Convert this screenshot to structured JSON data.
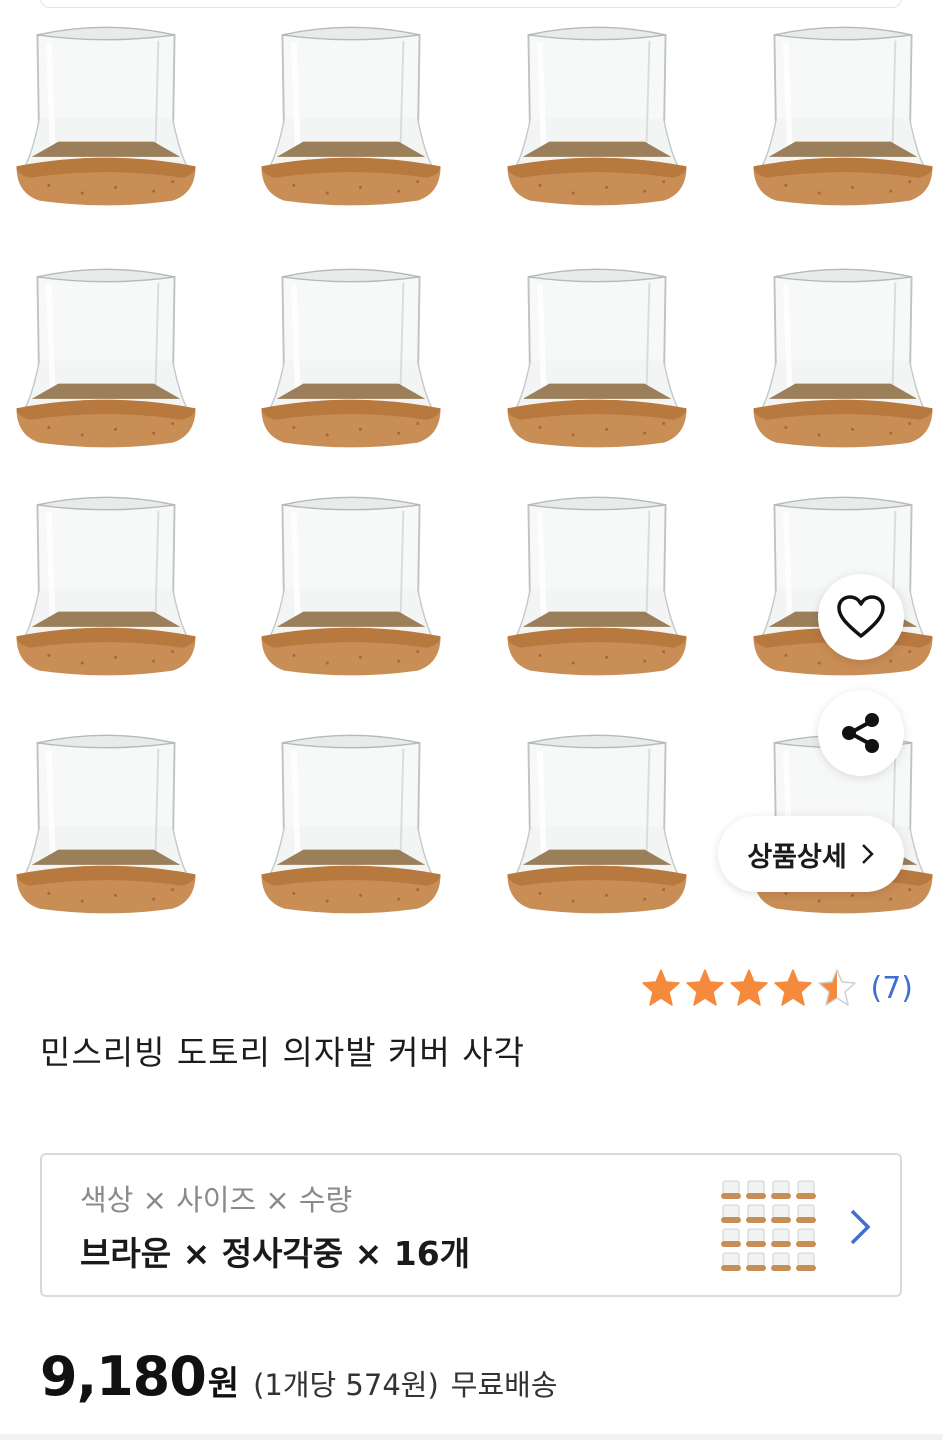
{
  "product": {
    "title": "민스리빙 도토리 의자발 커버 사각",
    "image_alt": "product-photo",
    "grid": {
      "rows": 4,
      "cols": 4
    }
  },
  "actions": {
    "wishlist_icon": "heart-outline-icon",
    "share_icon": "share-icon",
    "detail_label": "상품상세",
    "detail_icon": "chevron-right-icon"
  },
  "rating": {
    "stars": 4.5,
    "max": 5,
    "count_text": "(7)",
    "star_color": "#f58a3c"
  },
  "option": {
    "label": "색상 × 사이즈 × 수량",
    "value": "브라운 × 정사각중 × 16개",
    "chevron_icon": "chevron-right-icon",
    "chevron_color": "#3d6fcf"
  },
  "price": {
    "amount": "9,180",
    "currency": "원",
    "unit_price": "(1개당 574원)",
    "shipping": "무료배송"
  }
}
